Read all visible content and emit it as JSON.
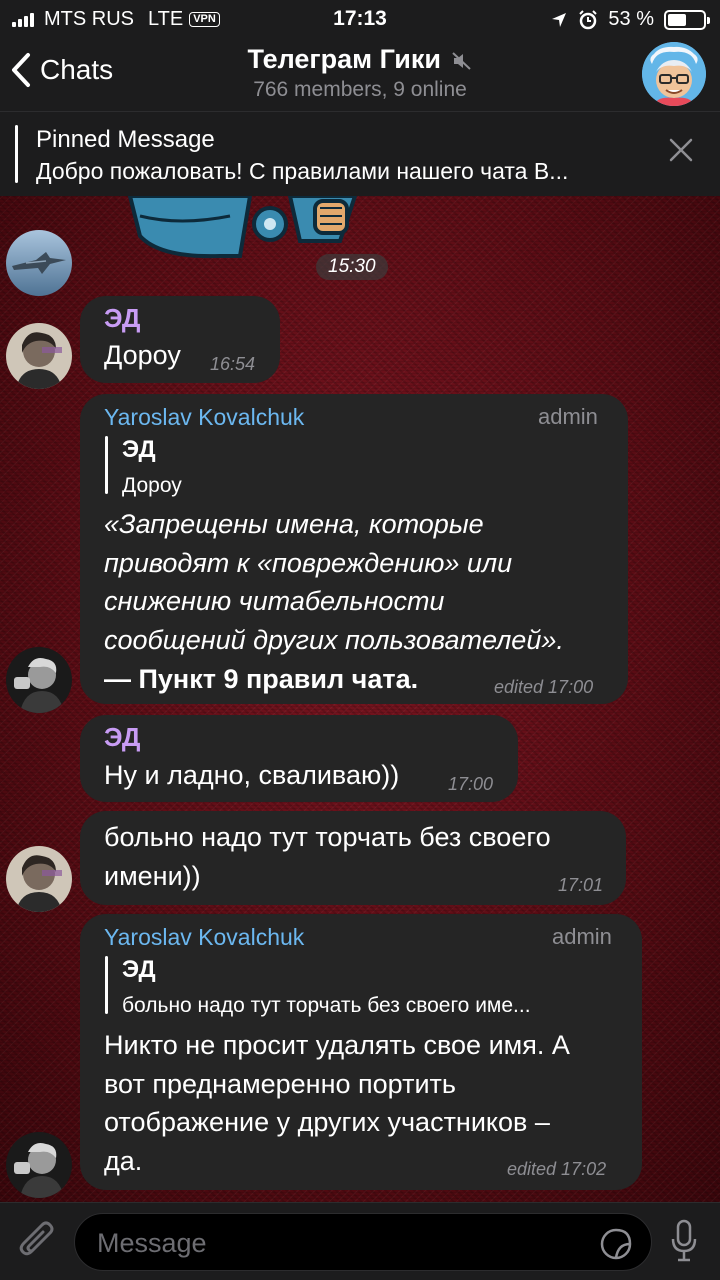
{
  "status_bar": {
    "carrier": "MTS RUS",
    "network": "LTE",
    "vpn": "VPN",
    "time": "17:13",
    "battery_text": "53 %",
    "battery_level": 0.53
  },
  "header": {
    "back_label": "Chats",
    "title": "Телеграм Гики",
    "subtitle": "766 members, 9 online"
  },
  "pinned": {
    "title": "Pinned Message",
    "text": "Добро пожаловать! С правилами нашего чата В..."
  },
  "messages": {
    "sticker_time": "15:30",
    "m1": {
      "sender": "ЭД",
      "text": "Дороу",
      "time": "16:54"
    },
    "m2": {
      "sender": "Yaroslav Kovalchuk",
      "role": "admin",
      "quote_name": "ЭД",
      "quote_text": "Дороу",
      "lines": [
        "«Запрещены имена, которые",
        "приводят к «повреждению» или",
        "снижению читабельности",
        "сообщений других пользователей»."
      ],
      "bold_line": "— Пункт 9 правил чата.",
      "time": "edited 17:00"
    },
    "m3": {
      "sender": "ЭД",
      "text": "Ну и ладно, сваливаю))",
      "time": "17:00"
    },
    "m4": {
      "lines": [
        "больно надо тут торчать без своего",
        "имени))"
      ],
      "time": "17:01"
    },
    "m5": {
      "sender": "Yaroslav Kovalchuk",
      "role": "admin",
      "quote_name": "ЭД",
      "quote_text": "больно надо тут торчать без своего име...",
      "lines": [
        "Никто не просит удалять свое имя. А",
        "вот преднамеренно портить",
        "отображение у других участников –",
        "да."
      ],
      "time": "edited 17:02"
    }
  },
  "input": {
    "placeholder": "Message"
  }
}
